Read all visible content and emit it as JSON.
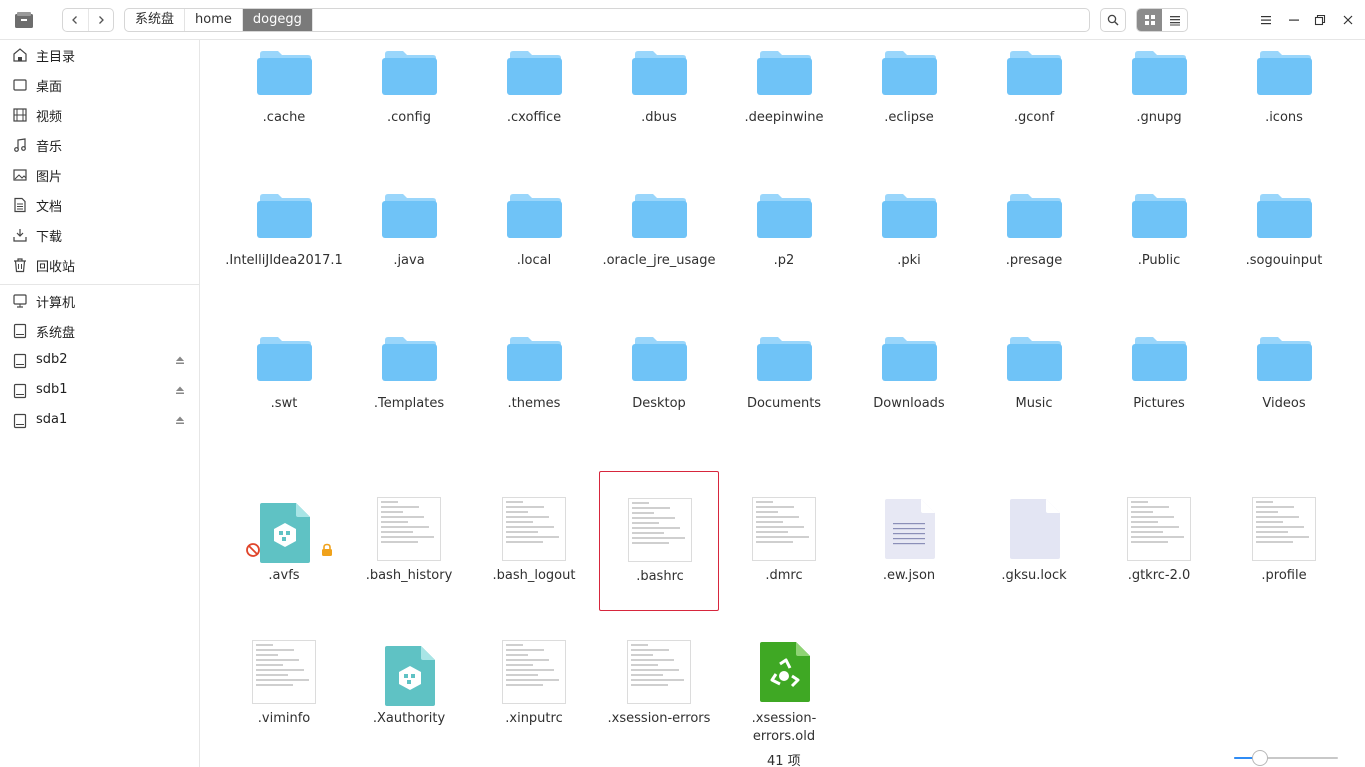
{
  "breadcrumb": [
    "系统盘",
    "home",
    "dogegg"
  ],
  "sidebar": {
    "items": [
      {
        "label": "主目录",
        "icon": "home-icon"
      },
      {
        "label": "桌面",
        "icon": "desktop-icon"
      },
      {
        "label": "视频",
        "icon": "video-icon"
      },
      {
        "label": "音乐",
        "icon": "music-icon"
      },
      {
        "label": "图片",
        "icon": "picture-icon"
      },
      {
        "label": "文档",
        "icon": "document-icon"
      },
      {
        "label": "下载",
        "icon": "download-icon"
      },
      {
        "label": "回收站",
        "icon": "trash-icon"
      }
    ],
    "devices": [
      {
        "label": "计算机",
        "icon": "computer-icon"
      },
      {
        "label": "系统盘",
        "icon": "disk-icon"
      },
      {
        "label": "sdb2",
        "icon": "disk-icon",
        "eject": true
      },
      {
        "label": "sdb1",
        "icon": "disk-icon",
        "eject": true
      },
      {
        "label": "sda1",
        "icon": "disk-icon",
        "eject": true
      }
    ]
  },
  "files": [
    {
      "name": ".cache",
      "kind": "folder"
    },
    {
      "name": ".config",
      "kind": "folder"
    },
    {
      "name": ".cxoffice",
      "kind": "folder"
    },
    {
      "name": ".dbus",
      "kind": "folder"
    },
    {
      "name": ".deepinwine",
      "kind": "folder"
    },
    {
      "name": ".eclipse",
      "kind": "folder"
    },
    {
      "name": ".gconf",
      "kind": "folder"
    },
    {
      "name": ".gnupg",
      "kind": "folder"
    },
    {
      "name": ".icons",
      "kind": "folder"
    },
    {
      "name": ".IntelliJIdea2017.1",
      "kind": "folder"
    },
    {
      "name": ".java",
      "kind": "folder"
    },
    {
      "name": ".local",
      "kind": "folder"
    },
    {
      "name": ".oracle_jre_usage",
      "kind": "folder"
    },
    {
      "name": ".p2",
      "kind": "folder"
    },
    {
      "name": ".pki",
      "kind": "folder"
    },
    {
      "name": ".presage",
      "kind": "folder"
    },
    {
      "name": ".Public",
      "kind": "folder"
    },
    {
      "name": ".sogouinput",
      "kind": "folder"
    },
    {
      "name": ".swt",
      "kind": "folder"
    },
    {
      "name": ".Templates",
      "kind": "folder"
    },
    {
      "name": ".themes",
      "kind": "folder"
    },
    {
      "name": "Desktop",
      "kind": "folder"
    },
    {
      "name": "Documents",
      "kind": "folder"
    },
    {
      "name": "Downloads",
      "kind": "folder"
    },
    {
      "name": "Music",
      "kind": "folder"
    },
    {
      "name": "Pictures",
      "kind": "folder"
    },
    {
      "name": "Videos",
      "kind": "folder"
    },
    {
      "name": ".avfs",
      "kind": "package-locked"
    },
    {
      "name": ".bash_history",
      "kind": "text"
    },
    {
      "name": ".bash_logout",
      "kind": "text"
    },
    {
      "name": ".bashrc",
      "kind": "text",
      "selected": true
    },
    {
      "name": ".dmrc",
      "kind": "text"
    },
    {
      "name": ".ew.json",
      "kind": "json"
    },
    {
      "name": ".gksu.lock",
      "kind": "blank"
    },
    {
      "name": ".gtkrc-2.0",
      "kind": "text"
    },
    {
      "name": ".profile",
      "kind": "text"
    },
    {
      "name": ".viminfo",
      "kind": "text"
    },
    {
      "name": ".Xauthority",
      "kind": "package"
    },
    {
      "name": ".xinputrc",
      "kind": "text"
    },
    {
      "name": ".xsession-errors",
      "kind": "text"
    },
    {
      "name": ".xsession-\nerrors.old",
      "kind": "recycle"
    }
  ],
  "status": {
    "count": "41 项"
  },
  "zoom": {
    "value": 0.25
  },
  "colors": {
    "folder": "#6fc3f7",
    "folder_tab": "#9ad6fb",
    "selection": "#d7263d",
    "accent": "#2f8cf5"
  }
}
